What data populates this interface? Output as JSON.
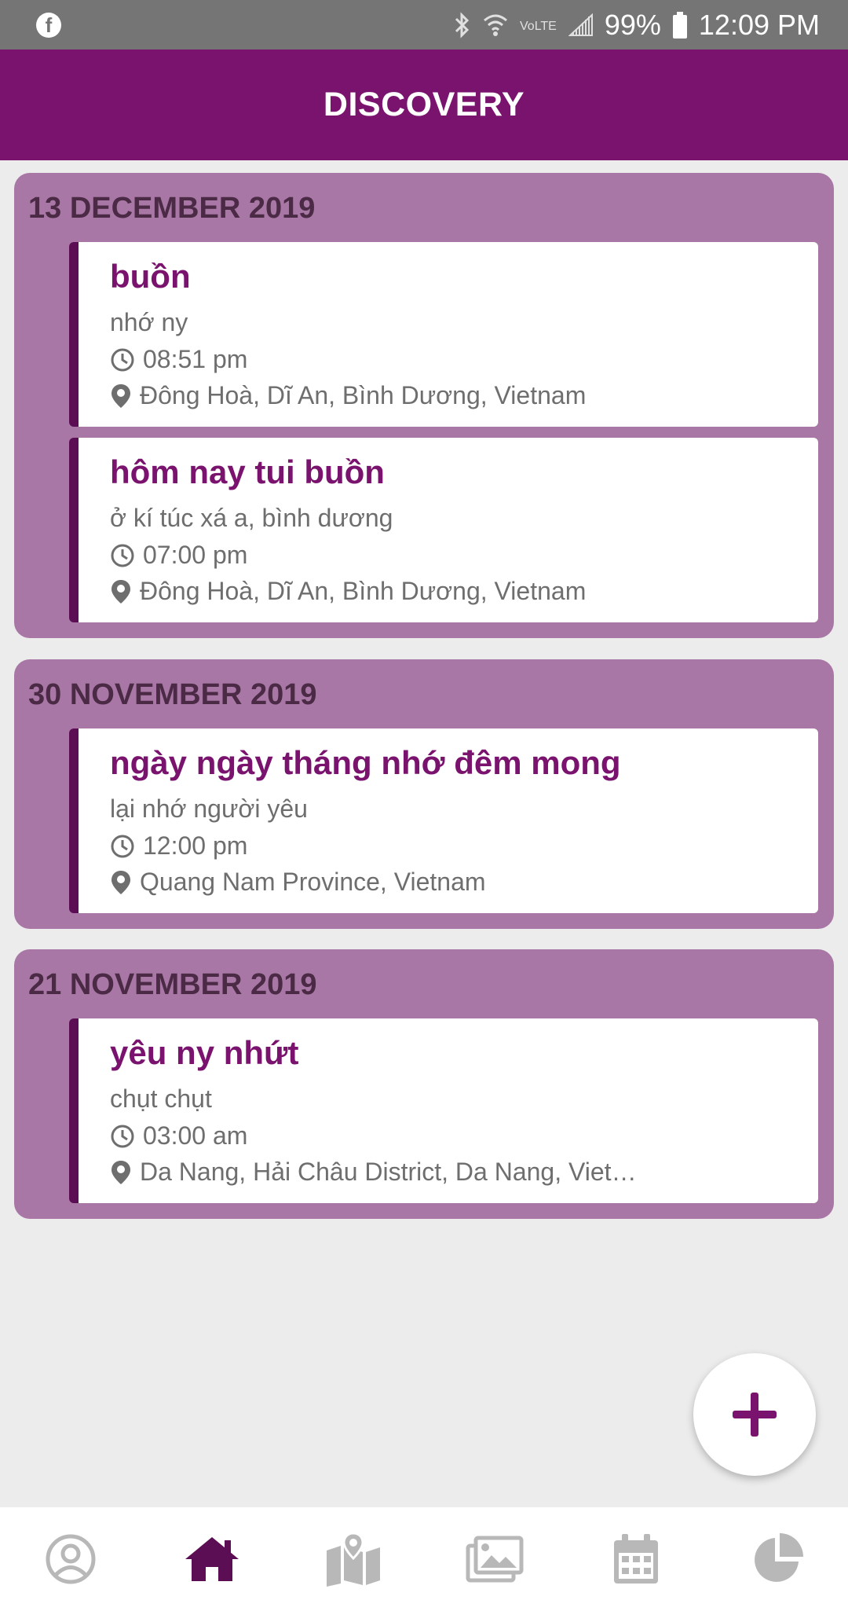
{
  "status_bar": {
    "left_icon": "facebook-icon",
    "icons": [
      "bluetooth-icon",
      "wifi-icon",
      "vowifi-icon",
      "signal-icon"
    ],
    "battery": "99%",
    "time": "12:09 PM"
  },
  "app_bar": {
    "title": "DISCOVERY"
  },
  "groups": [
    {
      "date": "13 DECEMBER 2019",
      "entries": [
        {
          "title": "buồn",
          "note": "nhớ ny",
          "time": "08:51 pm",
          "location": "Đông Hoà, Dĩ An, Bình Dương, Vietnam"
        },
        {
          "title": "hôm nay tui buồn",
          "note": "ở kí túc xá a, bình dương",
          "time": "07:00 pm",
          "location": "Đông Hoà, Dĩ An, Bình Dương, Vietnam"
        }
      ]
    },
    {
      "date": "30 NOVEMBER 2019",
      "entries": [
        {
          "title": "ngày ngày tháng nhớ đêm mong",
          "note": "lại nhớ người yêu",
          "time": "12:00 pm",
          "location": "Quang Nam Province, Vietnam"
        }
      ]
    },
    {
      "date": "21 NOVEMBER 2019",
      "entries": [
        {
          "title": "yêu ny nhứt",
          "note": "chụt chụt",
          "time": "03:00 am",
          "location": "Da Nang, Hải Châu District, Da Nang, Viet…"
        }
      ]
    }
  ],
  "fab": {
    "icon": "plus-icon"
  },
  "bottom_nav": {
    "items": [
      "profile-icon",
      "home-icon",
      "map-icon",
      "gallery-icon",
      "calendar-icon",
      "stats-icon"
    ],
    "active": "home-icon"
  },
  "colors": {
    "primary": "#7a136e",
    "group_bg": "#a877a5",
    "card_accent": "#5c0e55",
    "active_nav": "#5c0e55",
    "inactive_nav": "#b8b8b8"
  }
}
